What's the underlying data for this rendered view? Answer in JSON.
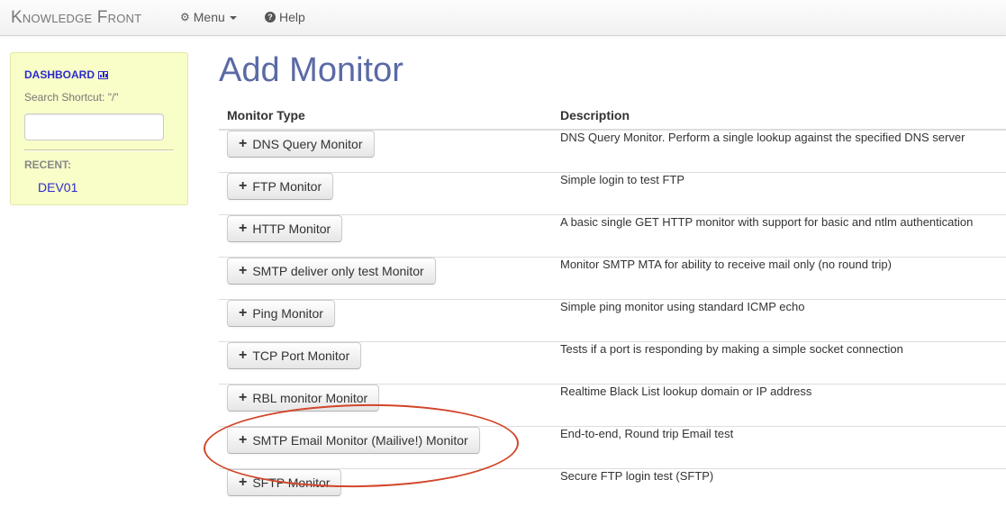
{
  "navbar": {
    "brand": "Knowledge Front",
    "menu_label": "Menu",
    "help_label": "Help",
    "menu_icon": "gears-icon",
    "help_icon": "question-circle-icon"
  },
  "sidebar": {
    "dashboard_label": "DASHBOARD",
    "dashboard_icon": "bar-chart-icon",
    "search_hint": "Search Shortcut: \"/\"",
    "search_value": "",
    "recent_label": "RECENT:",
    "recent_items": [
      "DEV01"
    ]
  },
  "main": {
    "title": "Add Monitor",
    "table": {
      "headers": [
        "Monitor Type",
        "Description"
      ],
      "rows": [
        {
          "button": "DNS Query Monitor",
          "description": "DNS Query Monitor. Perform a single lookup against the specified DNS server"
        },
        {
          "button": "FTP Monitor",
          "description": "Simple login to test FTP"
        },
        {
          "button": "HTTP Monitor",
          "description": "A basic single GET HTTP monitor with support for basic and ntlm authentication"
        },
        {
          "button": "SMTP deliver only test Monitor",
          "description": "Monitor SMTP MTA for ability to receive mail only (no round trip)"
        },
        {
          "button": "Ping Monitor",
          "description": "Simple ping monitor using standard ICMP echo"
        },
        {
          "button": "TCP Port Monitor",
          "description": "Tests if a port is responding by making a simple socket connection"
        },
        {
          "button": "RBL monitor Monitor",
          "description": "Realtime Black List lookup domain or IP address"
        },
        {
          "button": "SMTP Email Monitor (Mailive!) Monitor",
          "description": "End-to-end, Round trip Email test"
        },
        {
          "button": "SFTP Monitor",
          "description": "Secure FTP login test (SFTP)"
        }
      ]
    }
  },
  "colors": {
    "title": "#5a6aa6",
    "link": "#2b2bcc",
    "sidebar_bg": "#f9fdc8",
    "highlight": "#d2462a"
  }
}
